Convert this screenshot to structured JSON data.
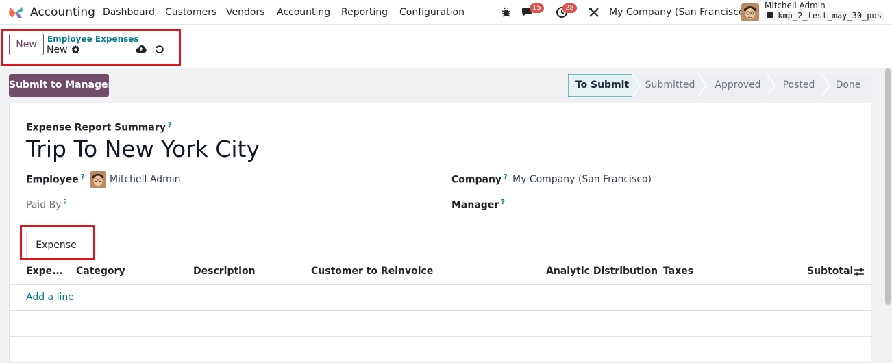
{
  "navbar": {
    "app_name": "Accounting",
    "menu": [
      "Dashboard",
      "Customers",
      "Vendors",
      "Accounting",
      "Reporting",
      "Configuration"
    ],
    "messages_count": "15",
    "activities_count": "28",
    "company": "My Company (San Francisco)",
    "user_name": "Mitchell Admin",
    "database": "kmp_2_test_may_30_pos",
    "icons": [
      "bug-icon",
      "chat-icon",
      "clock-icon",
      "tools-icon"
    ]
  },
  "control_panel": {
    "new_label": "New",
    "breadcrumb": "Employee Expenses",
    "current": "New"
  },
  "actions": {
    "submit_label": "Submit to Manager"
  },
  "status": {
    "stages": [
      "To Submit",
      "Submitted",
      "Approved",
      "Posted",
      "Done"
    ],
    "active": "To Submit"
  },
  "form": {
    "summary_label": "Expense Report Summary",
    "summary_value": "Trip To New York City",
    "employee_label": "Employee",
    "employee_value": "Mitchell Admin",
    "paid_by_label": "Paid By",
    "company_label": "Company",
    "company_value": "My Company (San Francisco)",
    "manager_label": "Manager",
    "help_mark": "?"
  },
  "tabs": [
    {
      "label": "Expense"
    }
  ],
  "table": {
    "columns": [
      "Expe...",
      "Category",
      "Description",
      "Customer to Reinvoice",
      "Analytic Distribution",
      "Taxes",
      "Subtotal"
    ],
    "add_line": "Add a line"
  },
  "colors": {
    "primary": "#714b67",
    "link": "#017e84",
    "highlight": "#e0141e"
  }
}
